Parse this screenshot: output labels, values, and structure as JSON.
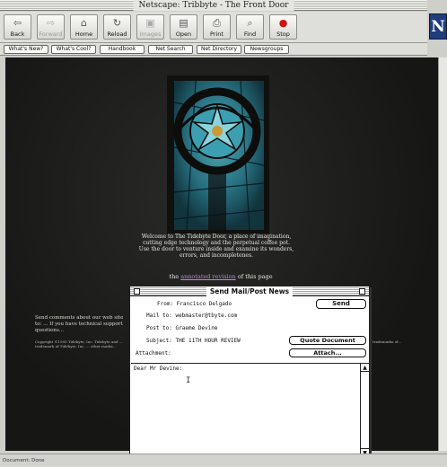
{
  "window": {
    "title": "Netscape: Tribbyte - The Front Door"
  },
  "toolbar": {
    "buttons": [
      {
        "label": "Back",
        "icon": "back-arrow-icon",
        "enabled": true
      },
      {
        "label": "Forward",
        "icon": "forward-arrow-icon",
        "enabled": false
      },
      {
        "label": "Home",
        "icon": "home-icon",
        "enabled": true
      },
      {
        "label": "Reload",
        "icon": "reload-icon",
        "enabled": true
      },
      {
        "label": "Images",
        "icon": "images-icon",
        "enabled": false
      },
      {
        "label": "Open",
        "icon": "open-icon",
        "enabled": true
      },
      {
        "label": "Print",
        "icon": "print-icon",
        "enabled": true
      },
      {
        "label": "Find",
        "icon": "find-icon",
        "enabled": true
      },
      {
        "label": "Stop",
        "icon": "stop-icon",
        "enabled": true
      }
    ]
  },
  "logo": {
    "letter": "N"
  },
  "directory": {
    "buttons": [
      "What's New?",
      "What's Cool?",
      "Handbook",
      "Net Search",
      "Net Directory",
      "Newsgroups"
    ]
  },
  "page": {
    "welcome_line1": "Welcome to The Tidebyte Door, a place of imagination,",
    "welcome_line2": "cutting edge technology and the perpetual coffee pot.",
    "welcome_line3": "Use the door to venture inside and examine its wonders,",
    "welcome_line4": "errors, and incompletenes.",
    "latest_prefix": "the",
    "latest_link": "annotated revision",
    "latest_suffix": "of this page",
    "comments": "Send comments about our web site to: ... If you have technical support questions...",
    "copyright": "Copyright ©1995 Tidebyte, Inc. Tidebyte and ... trademark of Tidebyte, Inc. ... other marks...",
    "copyright_right": "... trademarks of..."
  },
  "mail": {
    "title": "Send Mail/Post News",
    "from_label": "From:",
    "from_value": "Francisco Delgado",
    "mailto_label": "Mail to:",
    "mailto_value": "webmaster@tbyte.com",
    "postto_label": "Post to:",
    "postto_value": "Graeme Devine",
    "subject_label": "Subject:",
    "subject_value": "THE 11TH HOUR REVIEW",
    "attachment_label": "Attachment:",
    "send_label": "Send",
    "quote_label": "Quote Document",
    "attach_label": "Attach...",
    "body_text": "Dear Mr Devine:"
  },
  "status": {
    "text": "Document: Done"
  },
  "colors": {
    "page_bg": "#1b1b1a",
    "link": "#b98ad9",
    "stained_glass": "#3aa2b5"
  }
}
